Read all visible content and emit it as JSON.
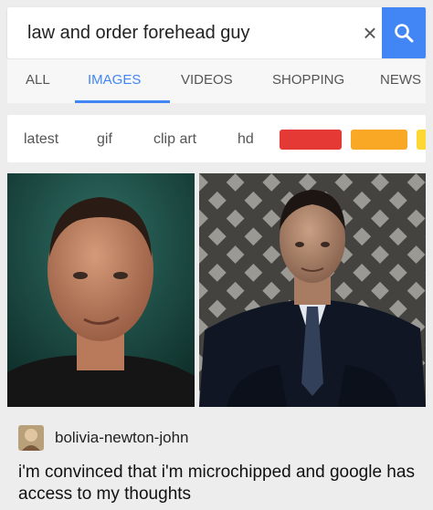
{
  "search": {
    "query": "law and order forehead guy",
    "clear_icon": "×"
  },
  "tabs": [
    {
      "label": "ALL"
    },
    {
      "label": "IMAGES",
      "active": true
    },
    {
      "label": "VIDEOS"
    },
    {
      "label": "SHOPPING"
    },
    {
      "label": "NEWS"
    }
  ],
  "filters": {
    "chips": [
      "latest",
      "gif",
      "clip art",
      "hd"
    ],
    "color_swatches": [
      "#e53935",
      "#f9a825",
      "#fdd835"
    ]
  },
  "colors": {
    "accent": "#4285f4"
  },
  "post": {
    "username": "bolivia-newton-john",
    "text": "i'm convinced that i'm microchipped and google has access to my thoughts"
  }
}
